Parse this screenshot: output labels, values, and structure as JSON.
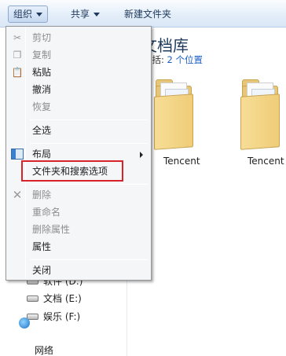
{
  "toolbar": {
    "organize": "组织",
    "share": "共享",
    "new_folder": "新建文件夹"
  },
  "library": {
    "title": "文档库",
    "subtitle_prefix": "包括:",
    "locations_link": "2 个位置"
  },
  "folders": [
    {
      "label": "Tencent"
    },
    {
      "label": "Tencent"
    }
  ],
  "context_menu": {
    "items": [
      {
        "label": "剪切",
        "enabled": false,
        "icon": "scissors-icon"
      },
      {
        "label": "复制",
        "enabled": false,
        "icon": "copy-icon"
      },
      {
        "label": "粘贴",
        "enabled": true,
        "icon": "paste-icon"
      },
      {
        "label": "撤消",
        "enabled": true
      },
      {
        "label": "恢复",
        "enabled": false
      },
      {
        "label": "全选",
        "enabled": true
      },
      {
        "label": "布局",
        "enabled": true,
        "icon": "layout-icon",
        "has_submenu": true
      },
      {
        "label": "文件夹和搜索选项",
        "enabled": true,
        "highlighted": true
      },
      {
        "label": "删除",
        "enabled": false,
        "icon": "delete-x-icon"
      },
      {
        "label": "重命名",
        "enabled": false
      },
      {
        "label": "删除属性",
        "enabled": false
      },
      {
        "label": "属性",
        "enabled": true
      },
      {
        "label": "关闭",
        "enabled": true
      }
    ],
    "highlight_color": "#d9232b"
  },
  "nav": {
    "drives": [
      {
        "label": "软件 (D:)"
      },
      {
        "label": "文档 (E:)"
      },
      {
        "label": "娱乐 (F:)"
      }
    ],
    "network": "网络"
  }
}
